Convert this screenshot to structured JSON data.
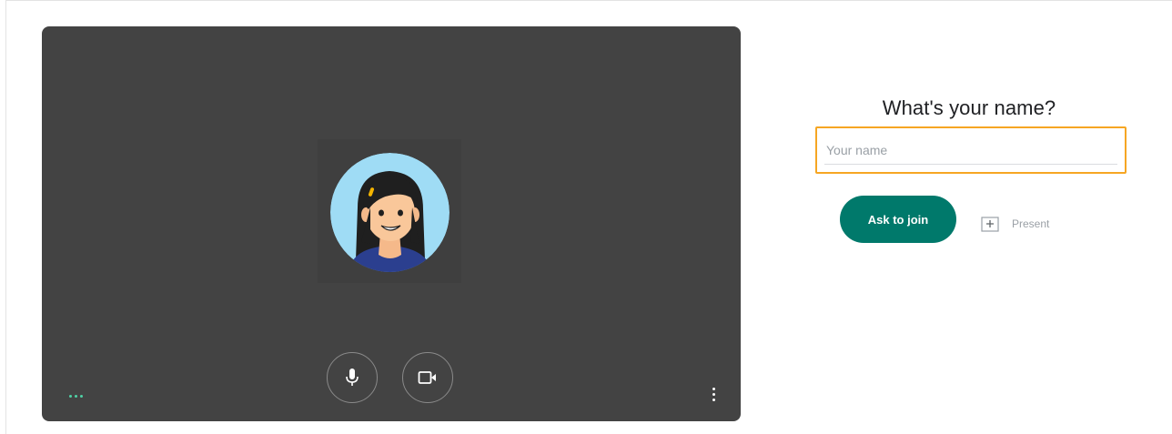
{
  "preview": {
    "mic_icon": "microphone-icon",
    "camera_icon": "video-camera-icon",
    "more_icon": "more-vert-icon",
    "audio_indicator_icon": "audio-level-dots-icon",
    "avatar": "user-avatar-illustration"
  },
  "join_panel": {
    "title": "What's your name?",
    "name_placeholder": "Your name",
    "name_value": "",
    "ask_to_join_label": "Ask to join",
    "present_label": "Present",
    "present_icon": "present-screen-icon"
  },
  "colors": {
    "preview_bg": "#434343",
    "join_button": "#00796b",
    "highlight_border": "#f6a623",
    "audio_dots": "#4fd1a5"
  }
}
